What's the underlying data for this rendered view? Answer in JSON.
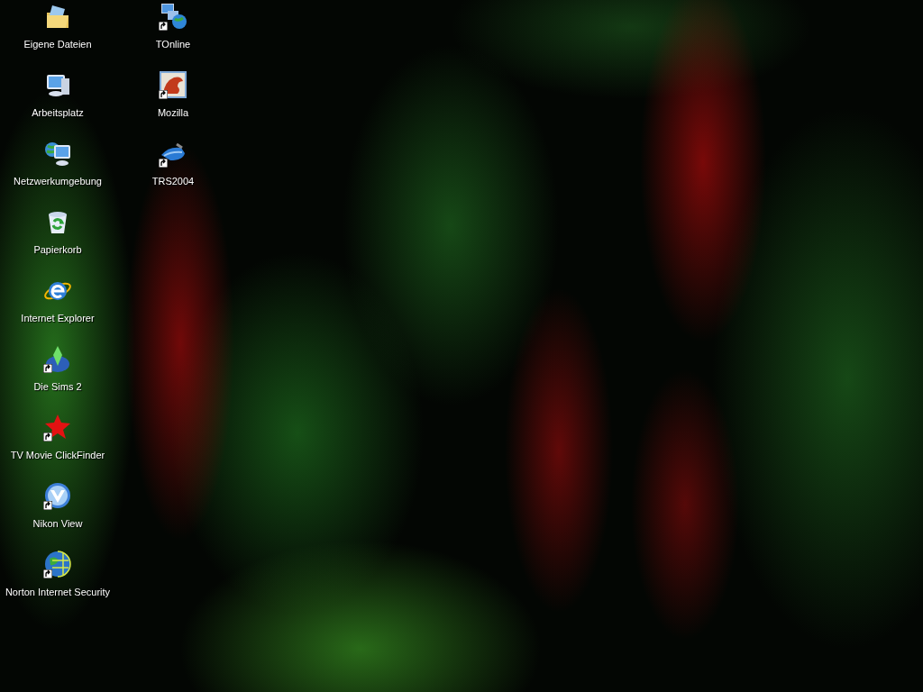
{
  "desktop_icons": [
    {
      "label": "Eigene Dateien",
      "kind": "folder",
      "shortcut": false
    },
    {
      "label": "Arbeitsplatz",
      "kind": "computer",
      "shortcut": false
    },
    {
      "label": "Netzwerkumgebung",
      "kind": "network",
      "shortcut": false
    },
    {
      "label": "Papierkorb",
      "kind": "recycle",
      "shortcut": false
    },
    {
      "label": "Internet Explorer",
      "kind": "browser",
      "shortcut": false
    },
    {
      "label": "Die Sims 2",
      "kind": "diamond",
      "shortcut": true
    },
    {
      "label": "TV Movie ClickFinder",
      "kind": "star",
      "shortcut": true
    },
    {
      "label": "Nikon View",
      "kind": "vlogo",
      "shortcut": true
    },
    {
      "label": "Norton Internet Security",
      "kind": "globe",
      "shortcut": true
    },
    {
      "label": "TOnline",
      "kind": "netglobe",
      "shortcut": true
    },
    {
      "label": "Mozilla",
      "kind": "dragon",
      "shortcut": true
    },
    {
      "label": "TRS2004",
      "kind": "device",
      "shortcut": true
    }
  ]
}
